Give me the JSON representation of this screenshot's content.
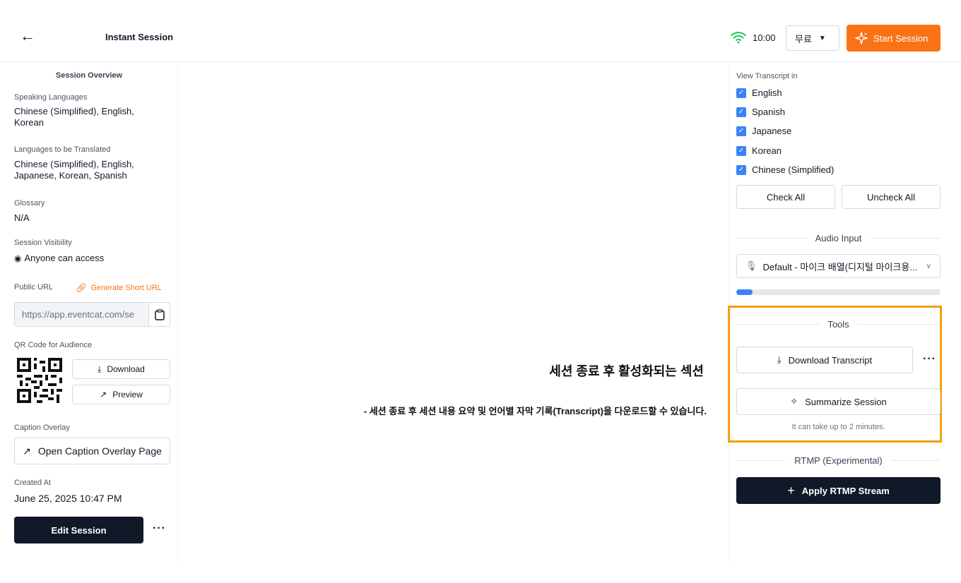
{
  "header": {
    "back_icon": "arrow-left-icon",
    "title": "Instant Session",
    "wifi_icon": "wifi-icon",
    "timer": "10:00",
    "plan_label": "무료",
    "start_label": "Start Session",
    "accent": "#f97316",
    "wifi_color": "#22c55e"
  },
  "left": {
    "overview_title": "Session Overview",
    "speaking_label": "Speaking Languages",
    "speaking_value": "Chinese (Simplified), English, Korean",
    "translated_label": "Languages to be Translated",
    "translated_value": "Chinese (Simplified), English, Japanese, Korean, Spanish",
    "glossary_label": "Glossary",
    "glossary_value": "N/A",
    "visibility_label": "Session Visibility",
    "visibility_value": "Anyone can access",
    "public_url_label": "Public URL",
    "short_url_label": "Generate Short URL",
    "url_value": "https://app.eventcat.com/se",
    "qr_label": "QR Code for Audience",
    "download_label": "Download",
    "preview_label": "Preview",
    "caption_label": "Caption Overlay",
    "caption_button": "Open Caption Overlay Page",
    "created_label": "Created At",
    "created_value": "June 25, 2025 10:47 PM",
    "edit_label": "Edit Session"
  },
  "annotation": {
    "title": "세션 종료 후 활성화되는 섹션",
    "description": "- 세션 종료 후 세션 내용 요약 및 언어별 자막 기록(Transcript)을 다운로드할 수 있습니다.",
    "highlight_color": "#f59e0b"
  },
  "right": {
    "view_label": "View Transcript in",
    "languages": [
      {
        "label": "English",
        "checked": true
      },
      {
        "label": "Spanish",
        "checked": true
      },
      {
        "label": "Japanese",
        "checked": true
      },
      {
        "label": "Korean",
        "checked": true
      },
      {
        "label": "Chinese (Simplified)",
        "checked": true
      }
    ],
    "check_all": "Check All",
    "uncheck_all": "Uncheck All",
    "audio_title": "Audio Input",
    "audio_device": "Default - 마이크 배열(디지털 마이크용...",
    "audio_level": 0.08,
    "tools_title": "Tools",
    "download_transcript": "Download Transcript",
    "summarize": "Summarize Session",
    "summarize_hint": "It can take up to 2 minutes.",
    "rtmp_title": "RTMP (Experimental)",
    "rtmp_button": "Apply RTMP Stream"
  }
}
